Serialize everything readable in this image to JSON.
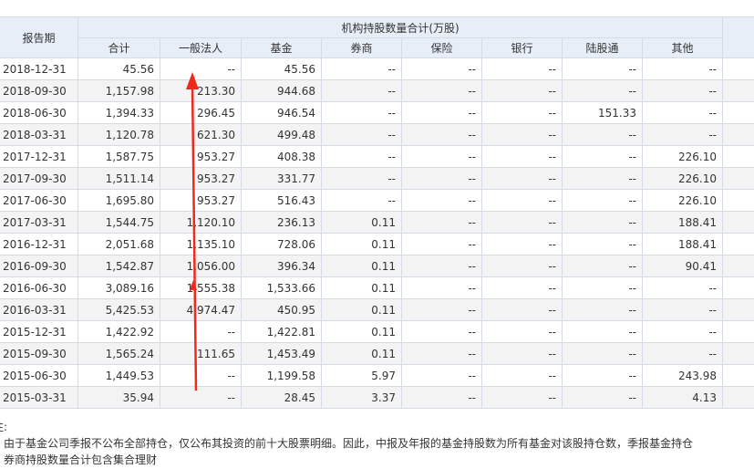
{
  "table": {
    "period_header": "报告期",
    "group_header": "机构持股数量合计(万股)",
    "columns": [
      "合计",
      "一般法人",
      "基金",
      "券商",
      "保险",
      "银行",
      "陆股通",
      "其他"
    ],
    "rows": [
      [
        "2018-12-31",
        "45.56",
        "--",
        "45.56",
        "--",
        "--",
        "--",
        "--",
        "--"
      ],
      [
        "2018-09-30",
        "1,157.98",
        "213.30",
        "944.68",
        "--",
        "--",
        "--",
        "--",
        "--"
      ],
      [
        "2018-06-30",
        "1,394.33",
        "296.45",
        "946.54",
        "--",
        "--",
        "--",
        "151.33",
        "--"
      ],
      [
        "2018-03-31",
        "1,120.78",
        "621.30",
        "499.48",
        "--",
        "--",
        "--",
        "--",
        "--"
      ],
      [
        "2017-12-31",
        "1,587.75",
        "953.27",
        "408.38",
        "--",
        "--",
        "--",
        "--",
        "226.10"
      ],
      [
        "2017-09-30",
        "1,511.14",
        "953.27",
        "331.77",
        "--",
        "--",
        "--",
        "--",
        "226.10"
      ],
      [
        "2017-06-30",
        "1,695.80",
        "953.27",
        "516.43",
        "--",
        "--",
        "--",
        "--",
        "226.10"
      ],
      [
        "2017-03-31",
        "1,544.75",
        "1,120.10",
        "236.13",
        "0.11",
        "--",
        "--",
        "--",
        "188.41"
      ],
      [
        "2016-12-31",
        "2,051.68",
        "1,135.10",
        "728.06",
        "0.11",
        "--",
        "--",
        "--",
        "188.41"
      ],
      [
        "2016-09-30",
        "1,542.87",
        "1,056.00",
        "396.34",
        "0.11",
        "--",
        "--",
        "--",
        "90.41"
      ],
      [
        "2016-06-30",
        "3,089.16",
        "1,555.38",
        "1,533.66",
        "0.11",
        "--",
        "--",
        "--",
        "--"
      ],
      [
        "2016-03-31",
        "5,425.53",
        "4,974.47",
        "450.95",
        "0.11",
        "--",
        "--",
        "--",
        "--"
      ],
      [
        "2015-12-31",
        "1,422.92",
        "--",
        "1,422.81",
        "0.11",
        "--",
        "--",
        "--",
        "--"
      ],
      [
        "2015-09-30",
        "1,565.24",
        "111.65",
        "1,453.49",
        "0.11",
        "--",
        "--",
        "--",
        "--"
      ],
      [
        "2015-06-30",
        "1,449.53",
        "--",
        "1,199.58",
        "5.97",
        "--",
        "--",
        "--",
        "243.98"
      ],
      [
        "2015-03-31",
        "35.94",
        "--",
        "28.45",
        "3.37",
        "--",
        "--",
        "--",
        "4.13"
      ]
    ]
  },
  "notes": {
    "title": "注:",
    "line1": "、由于基金公司季报不公布全部持仓，仅公布其投资的前十大股票明细。因此，中报及年报的基金持股数为所有基金对该股持仓数，季报基金持仓",
    "line2": "、券商持股数量合计包含集合理财"
  },
  "annotation": {
    "arrow_color": "#ee2a1f"
  }
}
